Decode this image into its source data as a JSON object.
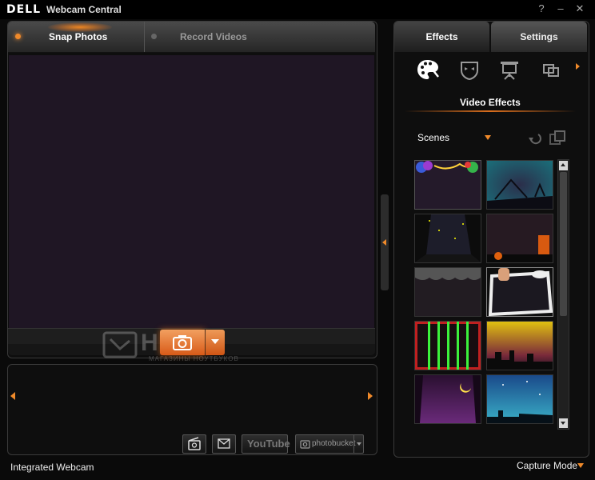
{
  "window": {
    "logo": "DELL",
    "title": "Webcam Central",
    "help": "?",
    "minimize": "–",
    "close": "✕"
  },
  "capture_tabs": [
    {
      "label": "Snap Photos",
      "active": true
    },
    {
      "label": "Record Videos",
      "active": false
    }
  ],
  "watermark": {
    "text": "НИК",
    "sub": "МАГАЗИНЫ НОУТБУКОВ"
  },
  "share_buttons": {
    "youtube": "YouTube",
    "photobucket": "photobucket"
  },
  "status": {
    "device": "Integrated Webcam",
    "mode": "Capture Mode"
  },
  "side_tabs": [
    {
      "label": "Effects",
      "active": true
    },
    {
      "label": "Settings",
      "active": false
    }
  ],
  "effects": {
    "section_title": "Video Effects",
    "category": "Scenes",
    "icons": [
      "palette-effects-icon",
      "mask-avatar-icon",
      "presentation-icon",
      "frames-icon"
    ]
  },
  "colors": {
    "accent": "#f08a2a",
    "preview_bg": "#1f1624"
  }
}
